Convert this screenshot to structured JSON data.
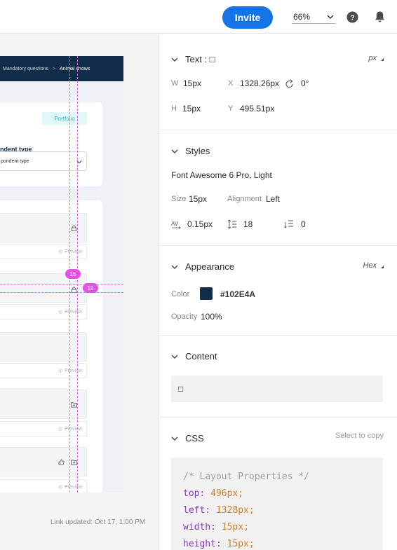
{
  "topbar": {
    "invite_label": "Invite",
    "zoom_value": "66%",
    "help_icon": "help-icon",
    "bell_icon": "bell-icon"
  },
  "canvas": {
    "breadcrumb": {
      "items": [
        "Mandatory questions",
        "Animal shows"
      ]
    },
    "portfolio_badge": "Portfolio",
    "respondent_label": "ndent type",
    "respondent_select": "pondent type",
    "preview_label": "Preview",
    "measure_badges": [
      "15",
      "15"
    ],
    "link_updated": "Link updated: Oct 17, 1:00 PM"
  },
  "panel": {
    "text_section": {
      "title": "Text : □",
      "unit": "px",
      "w_label": "W",
      "w_value": "15px",
      "x_label": "X",
      "x_value": "1328.26px",
      "rotation_value": "0°",
      "h_label": "H",
      "h_value": "15px",
      "y_label": "Y",
      "y_value": "495.51px"
    },
    "styles_section": {
      "title": "Styles",
      "font_name": "Font Awesome 6 Pro, Light",
      "size_label": "Size",
      "size_value": "15px",
      "alignment_label": "Alignment",
      "alignment_value": "Left",
      "letter_spacing": "0.15px",
      "line_height": "18",
      "paragraph_spacing": "0"
    },
    "appearance_section": {
      "title": "Appearance",
      "mode": "Hex",
      "color_label": "Color",
      "color_value": "#102E4A",
      "color_hex": "#102E4A",
      "opacity_label": "Opacity",
      "opacity_value": "100%"
    },
    "content_section": {
      "title": "Content",
      "value": "□"
    },
    "css_section": {
      "title": "CSS",
      "select_to_copy": "Select to copy",
      "comment": "/* Layout Properties */",
      "lines": [
        {
          "prop": "top:",
          "val": "496px;"
        },
        {
          "prop": "left:",
          "val": "1328px;"
        },
        {
          "prop": "width:",
          "val": "15px;"
        },
        {
          "prop": "height:",
          "val": "15px;"
        }
      ]
    }
  }
}
